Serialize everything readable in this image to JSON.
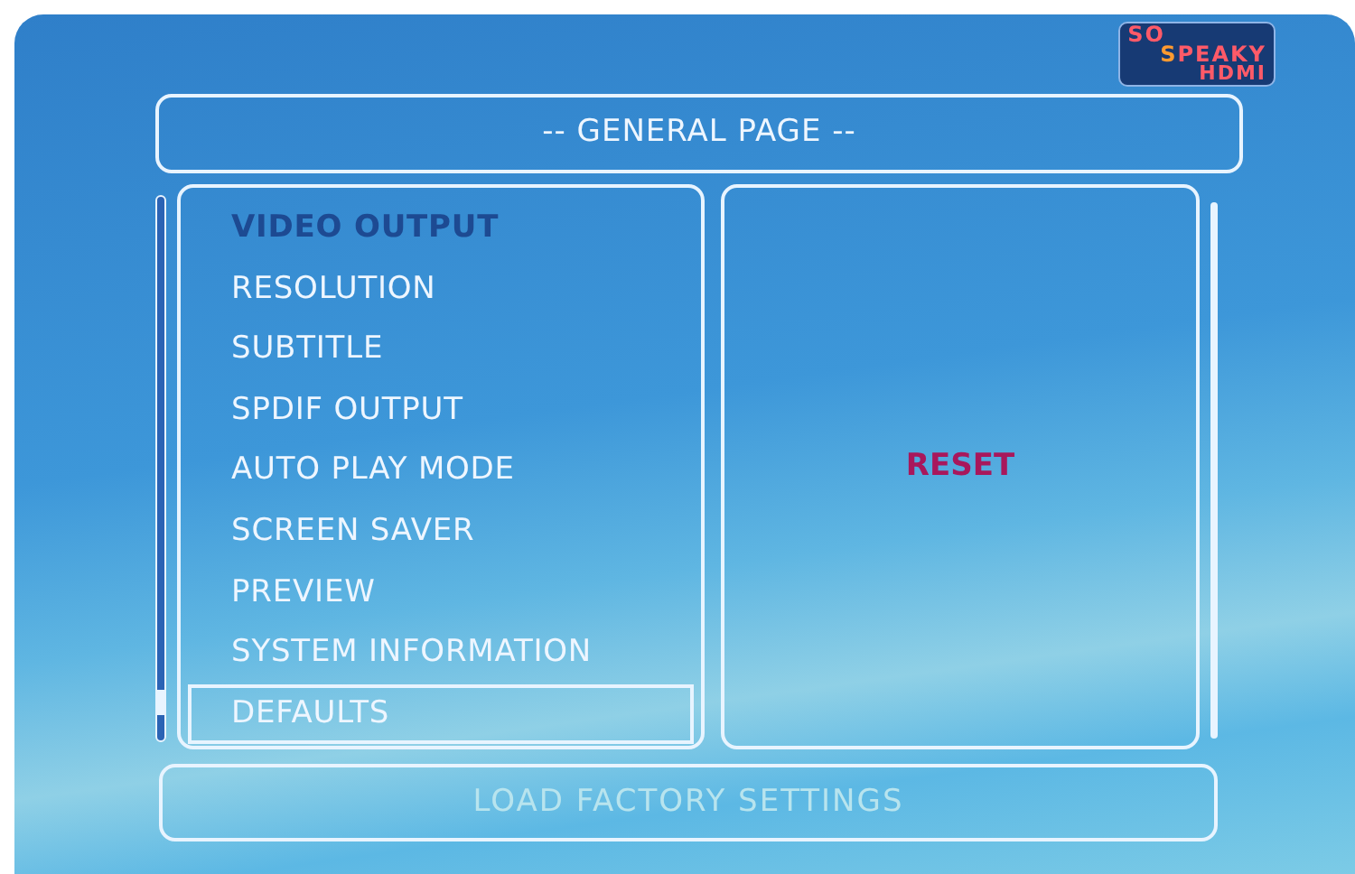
{
  "logo": {
    "line_1": "SO",
    "line_2": "**S**PEAKY",
    "line_3": "HDMI"
  },
  "header": {
    "title": "-- GENERAL PAGE --"
  },
  "menu": [
    {
      "label": "VIDEO OUTPUT",
      "kind": "heading",
      "selected": false
    },
    {
      "label": "RESOLUTION",
      "kind": "item",
      "selected": false
    },
    {
      "label": "SUBTITLE",
      "kind": "item",
      "selected": false
    },
    {
      "label": "SPDIF OUTPUT",
      "kind": "item",
      "selected": false
    },
    {
      "label": "AUTO PLAY MODE",
      "kind": "item",
      "selected": false
    },
    {
      "label": "SCREEN SAVER",
      "kind": "item",
      "selected": false
    },
    {
      "label": "PREVIEW",
      "kind": "item",
      "selected": false
    },
    {
      "label": "SYSTEM INFORMATION",
      "kind": "item",
      "selected": false
    },
    {
      "label": "DEFAULTS",
      "kind": "item",
      "selected": true
    }
  ],
  "options": [
    {
      "label": "RESET"
    }
  ],
  "help": {
    "text": "LOAD FACTORY SETTINGS"
  }
}
